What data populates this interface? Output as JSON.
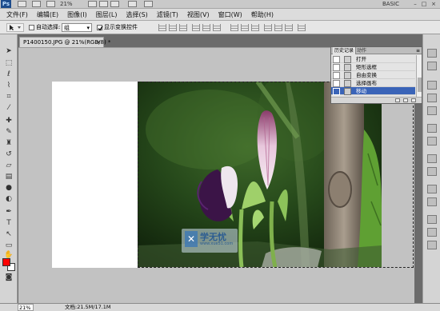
{
  "app": {
    "logo": "Ps",
    "zoom": "21%",
    "workspace": "BASIC",
    "window_controls": [
      "–",
      "□",
      "×"
    ]
  },
  "menu": [
    "文件(F)",
    "编辑(E)",
    "图像(I)",
    "图层(L)",
    "选择(S)",
    "滤镜(T)",
    "视图(V)",
    "窗口(W)",
    "帮助(H)"
  ],
  "options": {
    "auto_select_label": "自动选择:",
    "auto_select_value": "组",
    "show_transform_label": "显示变换控件"
  },
  "document": {
    "tab_title": "P1400150.JPG @ 21%(RGB/8) *"
  },
  "history_panel": {
    "tabs": [
      "历史记录",
      "动作"
    ],
    "menu_icon": "≡",
    "items": [
      {
        "label": "打开",
        "selected": false
      },
      {
        "label": "矩形选框",
        "selected": false
      },
      {
        "label": "自由变换",
        "selected": false
      },
      {
        "label": "选择画布",
        "selected": false
      },
      {
        "label": "移动",
        "selected": true
      }
    ]
  },
  "watermark": {
    "text": "学无忧",
    "url": "www.xue51.com"
  },
  "status": {
    "zoom": "21%",
    "doc_size": "文档:21.5M/17.1M"
  },
  "colors": {
    "foreground": "#ff0000",
    "background": "#ffffff",
    "selection_highlight": "#3a64b8"
  },
  "tools": [
    "move-tool-icon",
    "marquee-tool-icon",
    "lasso-tool-icon",
    "quick-select-tool-icon",
    "crop-tool-icon",
    "eyedropper-tool-icon",
    "healing-brush-icon",
    "brush-tool-icon",
    "clone-stamp-icon",
    "history-brush-icon",
    "eraser-tool-icon",
    "gradient-tool-icon",
    "blur-tool-icon",
    "dodge-tool-icon",
    "pen-tool-icon",
    "type-tool-icon",
    "path-select-icon",
    "shape-tool-icon",
    "hand-tool-icon",
    "zoom-tool-icon"
  ]
}
